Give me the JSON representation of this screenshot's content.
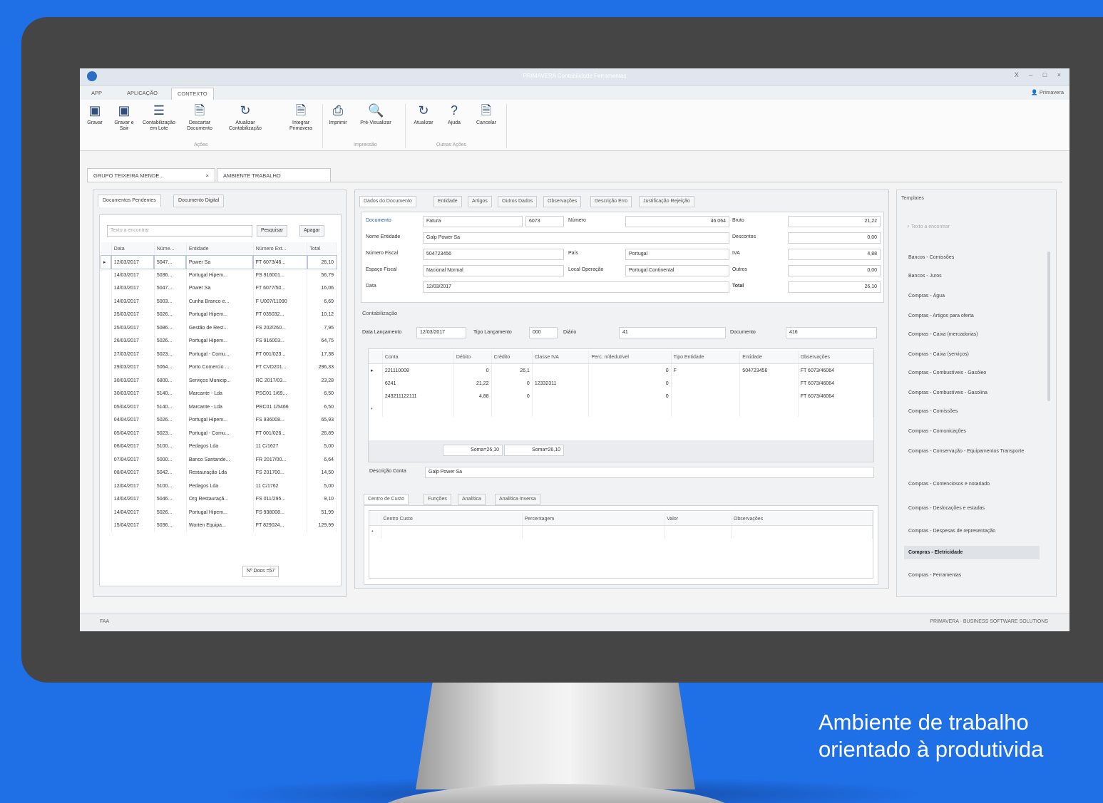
{
  "tagline": {
    "line1": "Ambiente de trabalho",
    "line2": "orientado à produtivida"
  },
  "window": {
    "title": "PRIMAVERA Contabilidade Ferramentas",
    "user": "Primavera",
    "controls": "X – □ ×"
  },
  "ribbon_tabs": [
    "APP",
    "APLICAÇÃO",
    "CONTEXTO"
  ],
  "ribbon": {
    "buttons": [
      {
        "label": "Gravar",
        "icon": "save-icon"
      },
      {
        "label": "Gravar e Sair",
        "icon": "save-close-icon"
      },
      {
        "label": "Contabilização em Lote",
        "icon": "list-icon"
      },
      {
        "label": "Descartar Documento",
        "icon": "discard-icon"
      },
      {
        "label": "Atualizar Contabilização",
        "icon": "refresh-icon"
      },
      {
        "label": "Integrar Primavera",
        "icon": "integrate-icon"
      },
      {
        "label": "Imprimir",
        "icon": "print-icon"
      },
      {
        "label": "Pré-Visualizar",
        "icon": "preview-icon"
      },
      {
        "label": "Atualizar",
        "icon": "refresh-icon"
      },
      {
        "label": "Ajuda",
        "icon": "help-icon"
      },
      {
        "label": "Cancelar",
        "icon": "cancel-icon"
      }
    ],
    "groups": [
      "Ações",
      "Impressão",
      "Outras Ações"
    ]
  },
  "doc_tabs": [
    "GRUPO TEIXEIRA MENDE...",
    "AMBIENTE TRABALHO"
  ],
  "left": {
    "tabs": [
      "Documentos Pendentes",
      "Documento Digital"
    ],
    "search_placeholder": "Texto a encontrar",
    "search_button": "Pesquisar",
    "clear_button": "Apagar",
    "columns": [
      "Data",
      "Núme...",
      "Entidade",
      "Número Ext...",
      "Total"
    ],
    "rows": [
      [
        "12/03/2017",
        "5047...",
        "Power Sa",
        "FT 6073/46...",
        "26,10"
      ],
      [
        "14/03/2017",
        "5036...",
        "Portugal Hipem...",
        "FS 916001...",
        "56,79"
      ],
      [
        "14/03/2017",
        "5047...",
        "Power Sa",
        "FT 6077/50...",
        "16,06"
      ],
      [
        "14/03/2017",
        "5003...",
        "Cunha Branco e...",
        "F U007/11090",
        "6,69"
      ],
      [
        "25/03/2017",
        "5026...",
        "Portugal Hipem...",
        "FT 035032...",
        "10,12"
      ],
      [
        "25/03/2017",
        "5086...",
        "Gestão de Rest...",
        "FS 202/260...",
        "7,95"
      ],
      [
        "26/03/2017",
        "5026...",
        "Portugal Hipem...",
        "FS 916003...",
        "64,75"
      ],
      [
        "27/03/2017",
        "5023...",
        "Portugal - Comu...",
        "FT 001/023...",
        "17,38"
      ],
      [
        "29/03/2017",
        "5064...",
        "Porto Comercio ...",
        "FT CVD201...",
        "296,33"
      ],
      [
        "30/03/2017",
        "6800...",
        "Serviços Municip...",
        "RC 2017/03...",
        "23,28"
      ],
      [
        "30/03/2017",
        "5140...",
        "Marcante - Lda",
        "PSC01 1/69...",
        "6,50"
      ],
      [
        "05/04/2017",
        "5140...",
        "Marcante - Lda",
        "PRC01 1/5466",
        "6,50"
      ],
      [
        "04/04/2017",
        "5026...",
        "Portugal Hipem...",
        "FS 936008...",
        "65,93"
      ],
      [
        "05/04/2017",
        "5023...",
        "Portugal - Comu...",
        "FT 001/026...",
        "26,89"
      ],
      [
        "06/04/2017",
        "5100...",
        "Pedagos Lda",
        "11 C/1627",
        "5,00"
      ],
      [
        "07/04/2017",
        "5000...",
        "Banco Santande...",
        "FR 2017/00...",
        "6,64"
      ],
      [
        "08/04/2017",
        "5042...",
        "Restauração Lda",
        "FS 201700...",
        "14,50"
      ],
      [
        "12/04/2017",
        "5100...",
        "Pedagos Lda",
        "11 C/1762",
        "5,00"
      ],
      [
        "14/04/2017",
        "5046...",
        "Org Restauraçã...",
        "FS 011/295...",
        "9,10"
      ],
      [
        "14/04/2017",
        "5026...",
        "Portugal Hipem...",
        "FS 938008...",
        "51,99"
      ],
      [
        "15/04/2017",
        "5036...",
        "Worten Equipa...",
        "FT 829024...",
        "129,99"
      ]
    ],
    "footer": "Nº Docs =57"
  },
  "doc": {
    "tabs": [
      "Dados do Documento",
      "Entidade",
      "Artigos",
      "Outros Dados",
      "Observações",
      "Descrição Erro",
      "Justificação Rejeição"
    ],
    "documento_label": "Documento",
    "documento_value": "Fatura",
    "serie_value": "6073",
    "numero_label": "Número",
    "numero_value": "46.064",
    "nome_entidade_label": "Nome Entidade",
    "nome_entidade_value": "Galp Power Sa",
    "numero_fiscal_label": "Número Fiscal",
    "numero_fiscal_value": "504723456",
    "pais_label": "País",
    "pais_value": "Portugal",
    "espaco_fiscal_label": "Espaço Fiscal",
    "espaco_fiscal_value": "Nacional Normal",
    "local_operacao_label": "Local Operação",
    "local_operacao_value": "Portugal Continental",
    "data_label": "Data",
    "data_value": "12/03/2017",
    "totals": [
      {
        "label": "Bruto",
        "value": "21,22"
      },
      {
        "label": "Descontos",
        "value": "0,00"
      },
      {
        "label": "IVA",
        "value": "4,88"
      },
      {
        "label": "Outros",
        "value": "0,00"
      },
      {
        "label": "Total",
        "value": "26,10"
      }
    ]
  },
  "contab": {
    "title": "Contabilização",
    "data_lanc_label": "Data Lançamento",
    "data_lanc_value": "12/03/2017",
    "tipo_lanc_label": "Tipo Lançamento",
    "tipo_lanc_value": "000",
    "diario_label": "Diário",
    "diario_value": "41",
    "documento_label": "Documento",
    "documento_value": "416",
    "columns": [
      "Conta",
      "Débito",
      "Crédito",
      "Classe IVA",
      "Perc. n/dedutível",
      "Tipo Entidade",
      "Entidade",
      "Observações"
    ],
    "rows": [
      [
        "221110008",
        "0",
        "26,1",
        "",
        "0",
        "F",
        "504723456",
        "FT 6073/46064"
      ],
      [
        "6241",
        "21,22",
        "0",
        "12332311",
        "0",
        "",
        "",
        "FT 6073/46064"
      ],
      [
        "243211122111",
        "4,88",
        "0",
        "",
        "0",
        "",
        "",
        "FT 6073/46064"
      ]
    ],
    "soma_debito": "Soma=26,10",
    "soma_credito": "Soma=26,10",
    "desc_conta_label": "Descrição Conta",
    "desc_conta_value": "Galp Power Sa"
  },
  "analytics": {
    "tabs": [
      "Centro de Custo",
      "Funções",
      "Analítica",
      "Analítica Inversa"
    ],
    "columns": [
      "Centro Custo",
      "Percentagem",
      "Valor",
      "Observações"
    ]
  },
  "templates": {
    "title": "Templates",
    "search_placeholder": "Texto a encontrar",
    "items": [
      "Bancos - Comissões",
      "Bancos - Juros",
      "Compras - Água",
      "Compras - Artigos para oferta",
      "Compras - Caixa (mercadorias)",
      "Compras - Caixa (serviços)",
      "Compras - Combustíveis - Gasóleo",
      "Compras - Combustíveis - Gasolina",
      "Compras - Comissões",
      "Compras - Comunicações",
      "Compras - Conservação - Equipamentos Transporte",
      "Compras - Contenciosos e notariado",
      "Compras - Deslocações e estadas",
      "Compras - Despesas de representação",
      "Compras - Eletricidade",
      "Compras - Ferramentas"
    ],
    "active_index": 14
  },
  "status": {
    "left": "FAA",
    "right": "PRIMAVERA · BUSINESS SOFTWARE SOLUTIONS"
  }
}
